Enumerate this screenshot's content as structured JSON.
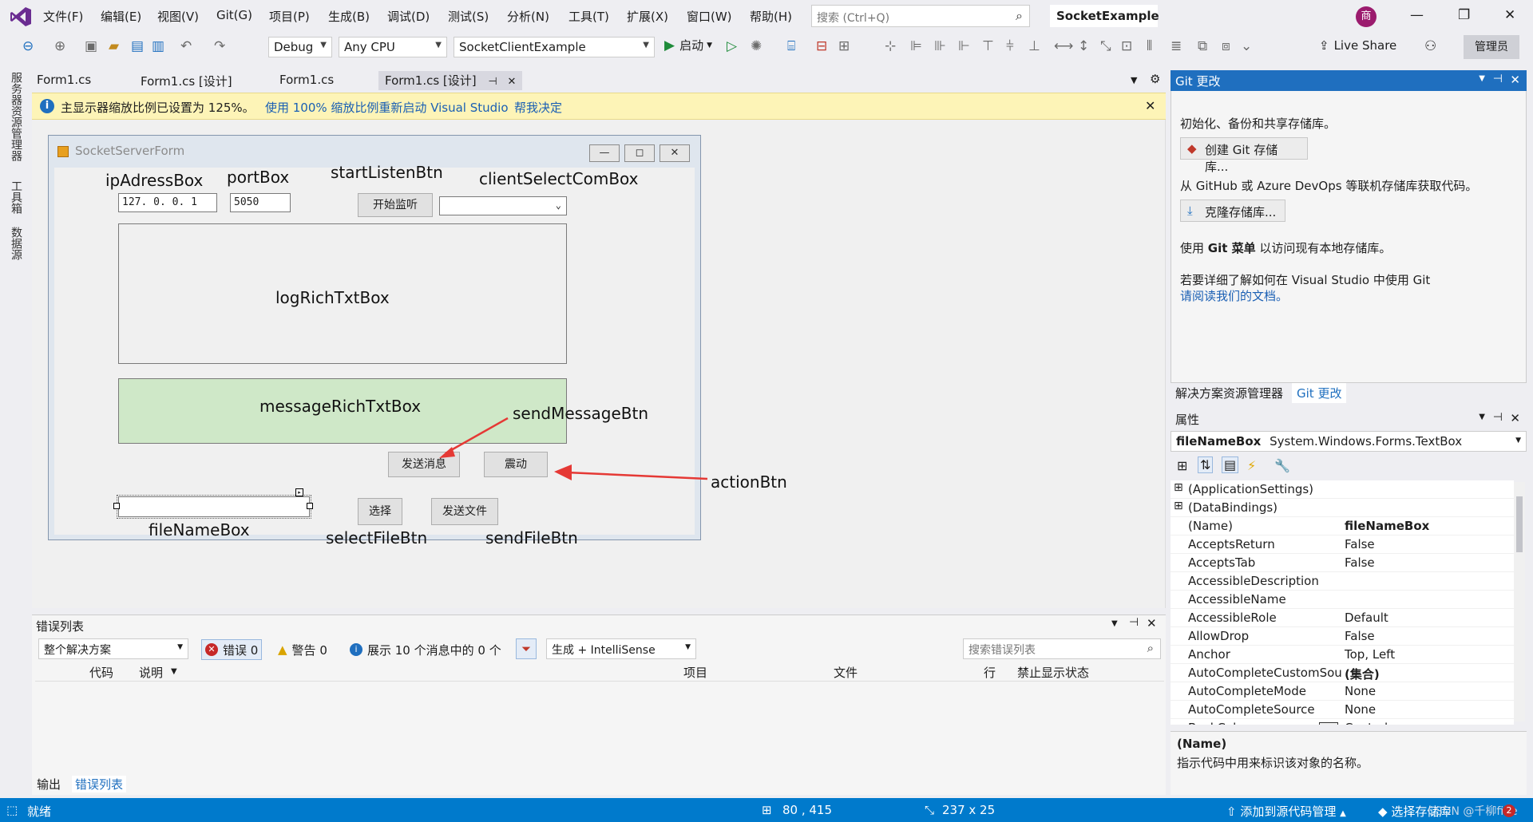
{
  "menu": {
    "items": [
      "文件(F)",
      "编辑(E)",
      "视图(V)",
      "Git(G)",
      "项目(P)",
      "生成(B)",
      "调试(D)",
      "测试(S)",
      "分析(N)",
      "工具(T)",
      "扩展(X)",
      "窗口(W)",
      "帮助(H)"
    ],
    "search_placeholder": "搜索 (Ctrl+Q)",
    "solution_name": "SocketExample",
    "avatar_initial": "商"
  },
  "toolbar": {
    "config": "Debug",
    "platform": "Any CPU",
    "startup_project": "SocketClientExample",
    "start_label": "启动",
    "live_share": "Live Share",
    "admin": "管理员"
  },
  "left_strip": [
    "服务器资源管理器",
    "工具箱",
    "数据源"
  ],
  "doc_tabs": [
    "Form1.cs",
    "Form1.cs [设计]",
    "Form1.cs",
    "Form1.cs [设计]"
  ],
  "infobar": {
    "message": "主显示器缩放比例已设置为 125%。",
    "link1": "使用 100% 缩放比例重新启动 Visual Studio",
    "link2": "帮我决定"
  },
  "form": {
    "title": "SocketServerForm",
    "ip_value": "127. 0. 0. 1",
    "port_value": "5050",
    "start_listen_text": "开始监听",
    "send_message_text": "发送消息",
    "action_text": "震动",
    "select_text": "选择",
    "send_file_text": "发送文件",
    "annotations": {
      "ip": "ipAdressBox",
      "port": "portBox",
      "start": "startListenBtn",
      "client": "clientSelectComBox",
      "log": "logRichTxtBox",
      "message": "messageRichTxtBox",
      "send_message": "sendMessageBtn",
      "action": "actionBtn",
      "file_name": "fileNameBox",
      "select_file": "selectFileBtn",
      "send_file": "sendFileBtn"
    }
  },
  "error_list": {
    "title": "错误列表",
    "scope": "整个解决方案",
    "errors": "错误 0",
    "warnings": "警告 0",
    "messages": "展示 10 个消息中的 0 个",
    "build": "生成 + IntelliSense",
    "search_placeholder": "搜索错误列表",
    "columns": [
      "代码",
      "说明",
      "项目",
      "文件",
      "行",
      "禁止显示状态"
    ],
    "bottom_tabs": [
      "输出",
      "错误列表"
    ]
  },
  "git": {
    "title": "Git 更改",
    "intro": "初始化、备份和共享存储库。",
    "create_btn": "创建 Git 存储库...",
    "clone_intro": "从 GitHub 或 Azure DevOps 等联机存储库获取代码。",
    "clone_btn": "克隆存储库...",
    "menu_hint_pre": "使用 ",
    "menu_hint_bold": "Git 菜单",
    "menu_hint_post": " 以访问现有本地存储库。",
    "learn_more": "若要详细了解如何在 Visual Studio 中使用 Git",
    "docs_link": "请阅读我们的文档。",
    "tabs": [
      "解决方案资源管理器",
      "Git 更改"
    ]
  },
  "properties": {
    "title": "属性",
    "object_name": "fileNameBox",
    "object_type": "System.Windows.Forms.TextBox",
    "rows": [
      {
        "name": "(ApplicationSettings)",
        "value": "",
        "expand": true
      },
      {
        "name": "(DataBindings)",
        "value": "",
        "expand": true
      },
      {
        "name": "(Name)",
        "value": "fileNameBox",
        "bold": true
      },
      {
        "name": "AcceptsReturn",
        "value": "False"
      },
      {
        "name": "AcceptsTab",
        "value": "False"
      },
      {
        "name": "AccessibleDescription",
        "value": ""
      },
      {
        "name": "AccessibleName",
        "value": ""
      },
      {
        "name": "AccessibleRole",
        "value": "Default"
      },
      {
        "name": "AllowDrop",
        "value": "False"
      },
      {
        "name": "Anchor",
        "value": "Top, Left"
      },
      {
        "name": "AutoCompleteCustomSou",
        "value": "(集合)",
        "bold": true
      },
      {
        "name": "AutoCompleteMode",
        "value": "None"
      },
      {
        "name": "AutoCompleteSource",
        "value": "None"
      },
      {
        "name": "BackColor",
        "value": "Control"
      }
    ],
    "desc_title": "(Name)",
    "desc_text": "指示代码中用来标识该对象的名称。"
  },
  "status": {
    "ready": "就绪",
    "position": "80 , 415",
    "size": "237 x 25",
    "add_source": "添加到源代码管理",
    "select_repo": "选择存储库",
    "watermark": "CSDN @千柳fine",
    "notif_count": "2"
  },
  "colors": {
    "accent": "#007acc",
    "message_box_bg": "#cfe8c8",
    "arrow": "#e53935"
  }
}
